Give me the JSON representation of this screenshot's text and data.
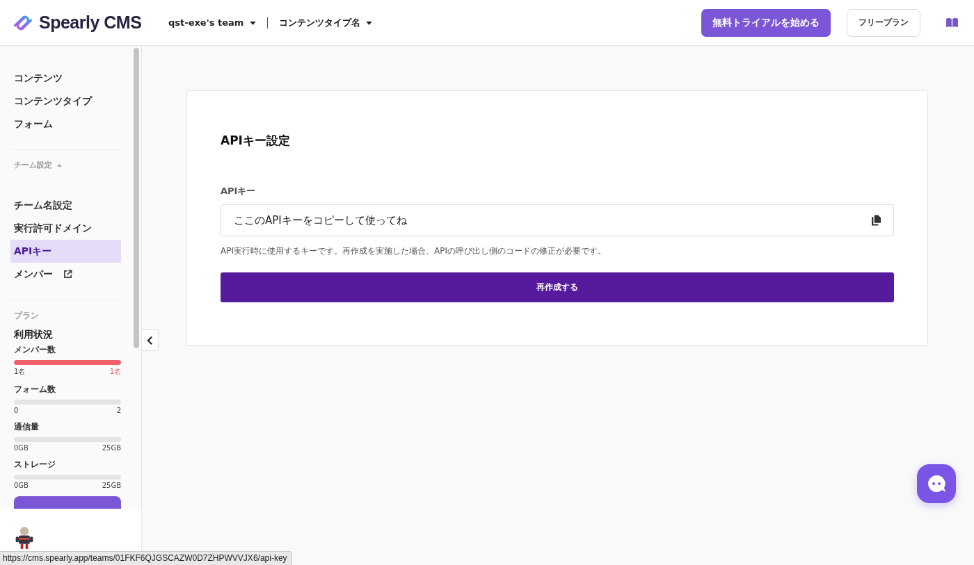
{
  "header": {
    "logo": "Spearly CMS",
    "team": "qst-exe's team",
    "content_type": "コンテンツタイプ名",
    "trial_button": "無料トライアルを始める",
    "plan_button": "フリープラン"
  },
  "sidebar": {
    "nav_items": [
      {
        "label": "コンテンツ",
        "selected": false
      },
      {
        "label": "コンテンツタイプ",
        "selected": false
      },
      {
        "label": "フォーム",
        "selected": false
      }
    ],
    "team_section": {
      "label": "チーム設定",
      "expanded": true,
      "items": [
        {
          "label": "チーム名設定",
          "selected": false,
          "external": false
        },
        {
          "label": "実行許可ドメイン",
          "selected": false,
          "external": false
        },
        {
          "label": "APIキー",
          "selected": true,
          "external": false
        },
        {
          "label": "メンバー",
          "selected": false,
          "external": true
        }
      ]
    },
    "plan_section": {
      "label": "プラン",
      "usage_title": "利用状況",
      "meters": [
        {
          "name": "メンバー数",
          "level": 1,
          "min_label": "1名",
          "max_label": "1名"
        },
        {
          "name": "フォーム数",
          "level": 0,
          "min_label": "0",
          "max_label": "2"
        },
        {
          "name": "通信量",
          "level": 0,
          "min_label": "0GB",
          "max_label": "25GB"
        },
        {
          "name": "ストレージ",
          "level": 0,
          "min_label": "0GB",
          "max_label": "25GB"
        }
      ]
    }
  },
  "main": {
    "title": "APIキー設定",
    "field_label": "APIキー",
    "field_value": "ここのAPIキーをコピーして使ってね",
    "help_text": "API実行時に使用するキーです。再作成を実施した場合、APIの呼び出し側のコードの修正が必要です。",
    "regenerate_button": "再作成する"
  },
  "status_bar": {
    "url": "https://cms.spearly.app/teams/01FKF6QJGSCAZW0D7ZHPWVVJX6/api-key"
  }
}
